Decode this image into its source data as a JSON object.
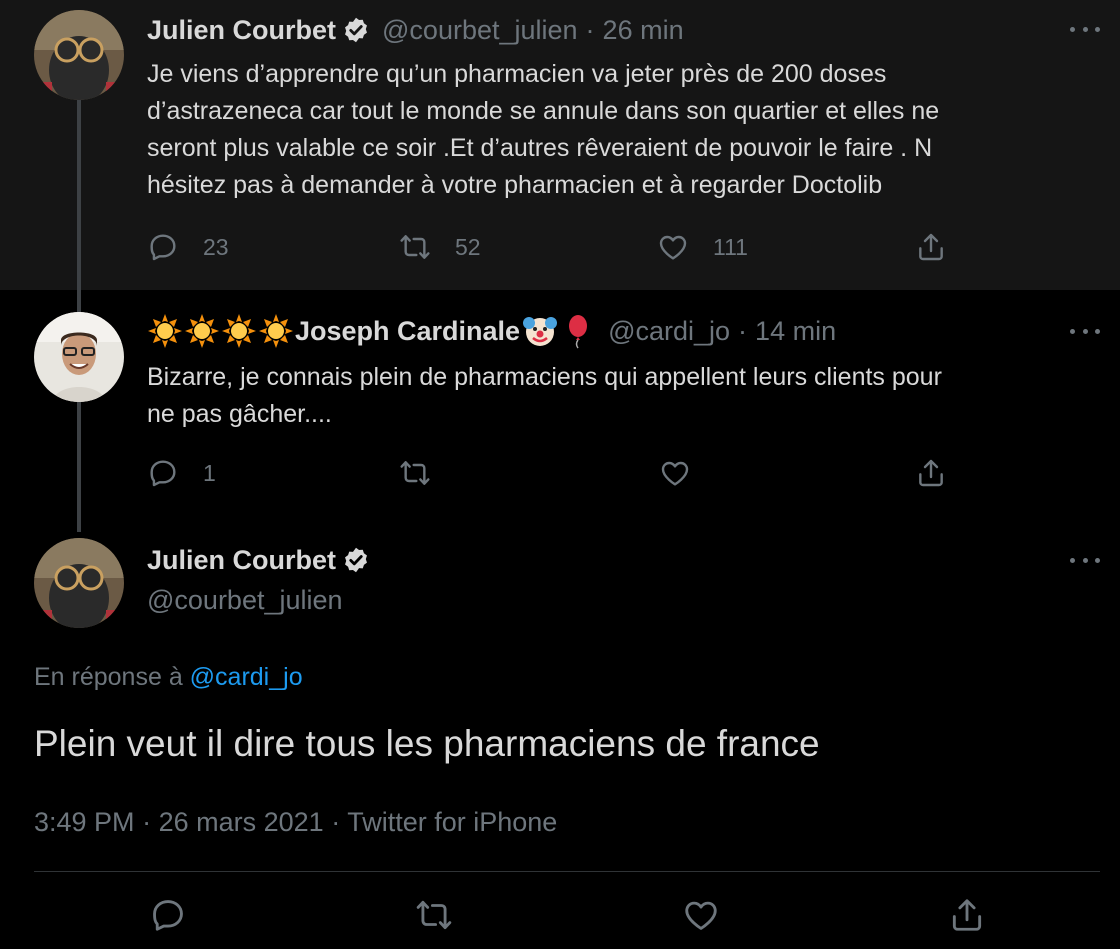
{
  "tweets": [
    {
      "display_name": "Julien Courbet",
      "handle": "@courbet_julien",
      "time": "26 min",
      "text_lines": [
        "Je viens d’apprendre qu’un pharmacien va jeter près de 200 doses",
        "d’astrazeneca car tout le monde se annule dans son quartier et elles ne",
        "seront plus valable ce soir .Et d’autres rêveraient de pouvoir le faire . N",
        "hésitez pas à demander à votre pharmacien et à regarder Doctolib"
      ],
      "replies": "23",
      "retweets": "52",
      "likes": "111"
    },
    {
      "display_name": "Joseph Cardinale",
      "handle": "@cardi_jo",
      "time": "14 min",
      "text_lines": [
        "Bizarre, je connais plein de pharmaciens qui appellent leurs clients pour",
        "ne pas gâcher...."
      ],
      "replies": "1",
      "retweets": "",
      "likes": ""
    }
  ],
  "main_tweet": {
    "display_name": "Julien Courbet",
    "handle": "@courbet_julien",
    "reply_prefix": "En réponse à ",
    "reply_mention": "@cardi_jo",
    "text": "Plein veut il dire tous les pharmaciens de france",
    "time": "3:49 PM",
    "date": "26 mars 2021",
    "source": "Twitter for iPhone"
  },
  "sep": "·",
  "colors": {
    "background": "#000000",
    "highlight_background": "#151515",
    "text": "#d9d9d9",
    "muted": "#6e767d",
    "link": "#1d9bf0",
    "thread_line": "#3d4145"
  },
  "icons": [
    "reply-icon",
    "retweet-icon",
    "like-icon",
    "share-icon",
    "more-icon",
    "verified-icon",
    "sun-emoji",
    "clown-emoji",
    "balloon-emoji"
  ]
}
